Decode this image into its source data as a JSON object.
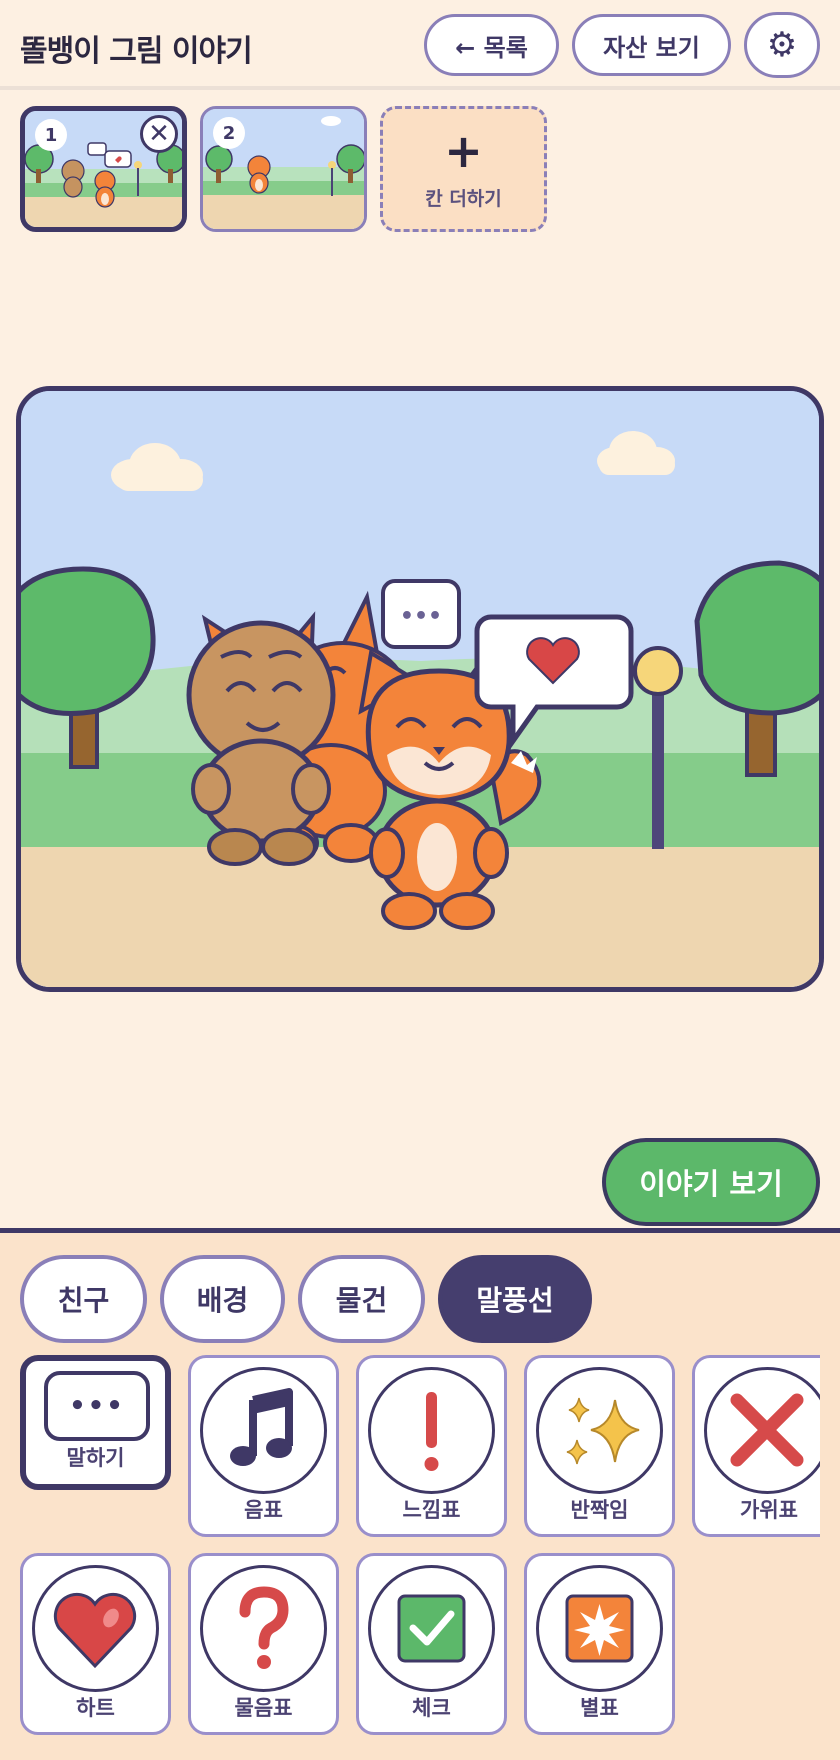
{
  "header": {
    "title": "똘뱅이 그림 이야기",
    "back_label": "← 목록",
    "assets_label": "자산 보기",
    "settings_icon": "⚙"
  },
  "pages": [
    {
      "number": "1",
      "selected": true
    },
    {
      "number": "2",
      "selected": false
    }
  ],
  "add_panel": {
    "plus": "+",
    "label": "칸 더하기"
  },
  "canvas": {
    "typing_bubble": "•••"
  },
  "story_button": "이야기 보기",
  "tabs": [
    {
      "label": "친구",
      "active": false
    },
    {
      "label": "배경",
      "active": false
    },
    {
      "label": "물건",
      "active": false
    },
    {
      "label": "말풍선",
      "active": true
    }
  ],
  "stickers": [
    {
      "label": "말하기",
      "icon": "speech-bubble-icon",
      "glyph": "•••"
    },
    {
      "label": "음표",
      "icon": "music-note-icon"
    },
    {
      "label": "느낌표",
      "icon": "exclamation-icon"
    },
    {
      "label": "반짝임",
      "icon": "sparkle-icon"
    },
    {
      "label": "가위표",
      "icon": "x-mark-icon"
    },
    {
      "label": "하트",
      "icon": "heart-icon"
    },
    {
      "label": "물음표",
      "icon": "question-icon"
    },
    {
      "label": "체크",
      "icon": "check-icon"
    },
    {
      "label": "별표",
      "icon": "starburst-icon"
    }
  ],
  "colors": {
    "accent": "#453e6e",
    "primary_green": "#5cb86a",
    "fox_orange": "#f3843a",
    "background": "#fdf0e2"
  }
}
